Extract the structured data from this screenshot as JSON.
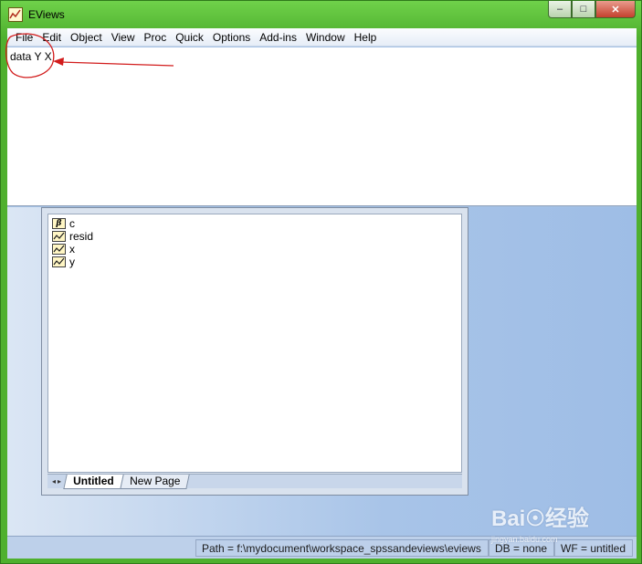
{
  "window": {
    "title": "EViews",
    "controls": {
      "minimize": "–",
      "maximize": "□",
      "close": "✕"
    }
  },
  "menu": [
    "File",
    "Edit",
    "Object",
    "View",
    "Proc",
    "Quick",
    "Options",
    "Add-ins",
    "Window",
    "Help"
  ],
  "command": {
    "text": "data  Y X"
  },
  "workfile": {
    "objects": [
      {
        "label": "c",
        "icon": "coefficient-icon",
        "glyph": "β"
      },
      {
        "label": "resid",
        "icon": "series-icon"
      },
      {
        "label": "x",
        "icon": "series-icon"
      },
      {
        "label": "y",
        "icon": "series-icon"
      }
    ],
    "tabs": [
      {
        "label": "Untitled",
        "active": true
      },
      {
        "label": "New Page",
        "active": false
      }
    ],
    "tab_nav": {
      "prev": "◂",
      "next": "▸"
    }
  },
  "status": {
    "path": "Path = f:\\mydocument\\workspace_spssandeviews\\eviews",
    "db": "DB = none",
    "wf": "WF = untitled"
  },
  "watermark": {
    "text": "Bai☉经验",
    "sub": "jingyan.baidu.com"
  },
  "colors": {
    "annotation": "#d21c1c",
    "frame": "#4fb02e",
    "desktop": "#a6c3e6"
  }
}
